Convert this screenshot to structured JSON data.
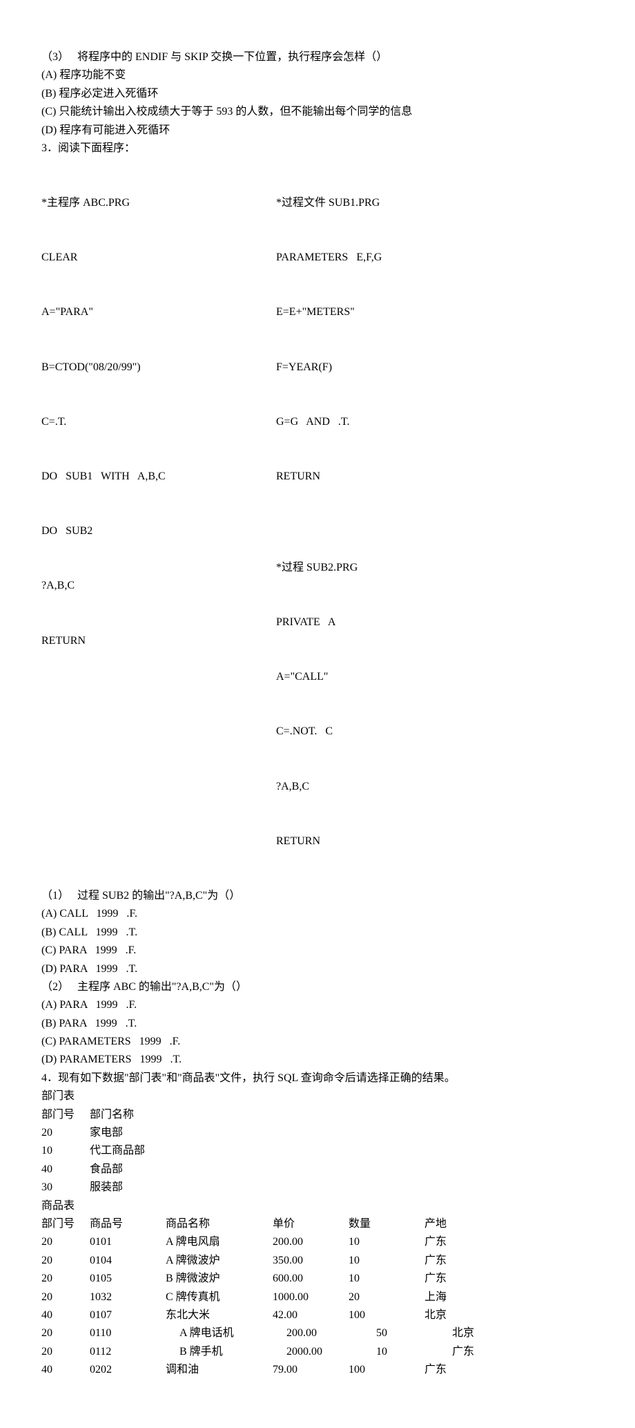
{
  "q2_3": {
    "prompt": "（3）   将程序中的 ENDIF 与 SKIP 交换一下位置，执行程序会怎样（）",
    "a": "(A) 程序功能不变",
    "b": "(B) 程序必定进入死循环",
    "c": "(C) 只能统计输出入校成绩大于等于 593 的人数，但不能输出每个同学的信息",
    "d": "(D) 程序有可能进入死循环"
  },
  "q3": {
    "intro": "3．阅读下面程序：",
    "left": [
      "*主程序 ABC.PRG",
      "CLEAR",
      "A=\"PARA\"",
      "B=CTOD(\"08/20/99\")",
      "C=.T.",
      "DO   SUB1   WITH   A,B,C",
      "DO   SUB2",
      "?A,B,C",
      "RETURN",
      "",
      "",
      "",
      ""
    ],
    "right": [
      "*过程文件 SUB1.PRG",
      "PARAMETERS   E,F,G",
      "E=E+\"METERS\"",
      "F=YEAR(F)",
      "G=G   AND   .T.",
      "RETURN",
      "",
      "*过程 SUB2.PRG",
      "PRIVATE   A",
      "A=\"CALL\"",
      "C=.NOT.   C",
      "?A,B,C",
      "RETURN"
    ],
    "p1": {
      "prompt": "（1）   过程 SUB2 的输出\"?A,B,C\"为（）",
      "a": "(A) CALL   1999   .F.",
      "b": "(B) CALL   1999   .T.",
      "c": "(C) PARA   1999   .F.",
      "d": "(D) PARA   1999   .T."
    },
    "p2": {
      "prompt": "（2）   主程序 ABC 的输出\"?A,B,C\"为（）",
      "a": "(A) PARA   1999   .F.",
      "b": "(B) PARA   1999   .T.",
      "c": "(C) PARAMETERS   1999   .F.",
      "d": "(D) PARAMETERS   1999   .T."
    }
  },
  "q4": {
    "intro": "4．现有如下数据\"部门表\"和\"商品表\"文件，执行 SQL 查询命令后请选择正确的结果。",
    "dept_title": "部门表",
    "dept_header": [
      "部门号",
      "部门名称"
    ],
    "dept_rows": [
      [
        "20",
        "家电部"
      ],
      [
        "10",
        "代工商品部"
      ],
      [
        "40",
        "食品部"
      ],
      [
        "30",
        "服装部"
      ]
    ],
    "prod_title": "商品表",
    "prod_header": [
      "部门号",
      "商品号",
      "商品名称",
      "单价",
      "数量",
      "产地"
    ],
    "prod_rows_a": [
      [
        "20",
        "0101",
        "A 牌电风扇",
        "200.00",
        "10",
        "广东"
      ],
      [
        "20",
        "0104",
        "A 牌微波炉",
        "350.00",
        "10",
        "广东"
      ],
      [
        "20",
        "0105",
        "B 牌微波炉",
        "600.00",
        "10",
        "广东"
      ],
      [
        "20",
        "1032",
        "C 牌传真机",
        "1000.00",
        "20",
        "上海"
      ],
      [
        "40",
        "0107",
        "东北大米",
        "42.00",
        "100",
        "北京"
      ]
    ],
    "prod_rows_b": [
      [
        "20",
        "0110",
        "A 牌电话机",
        "200.00",
        "50",
        "北京"
      ],
      [
        "20",
        "0112",
        "B 牌手机",
        "2000.00",
        "10",
        "广东"
      ]
    ],
    "prod_rows_c": [
      [
        "40",
        "0202",
        "调和油",
        "79.00",
        "100",
        "广东"
      ]
    ]
  }
}
